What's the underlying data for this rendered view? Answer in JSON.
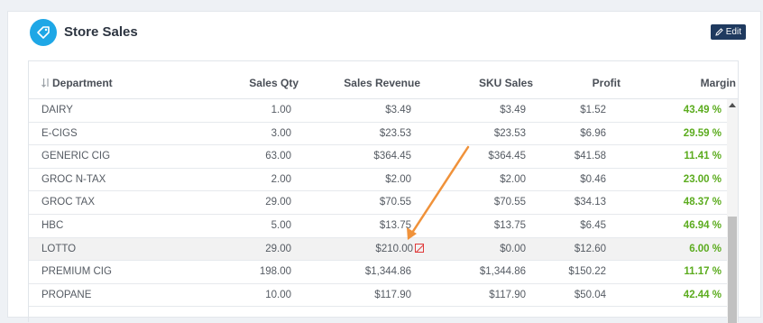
{
  "widget": {
    "title": "Store Sales",
    "edit_label": "Edit",
    "icon": "tag-icon"
  },
  "table": {
    "columns": [
      "Department",
      "Sales Qty",
      "Sales Revenue",
      "SKU Sales",
      "Profit",
      "Margin"
    ],
    "rows": [
      {
        "dept": "DAIRY",
        "qty": "1.00",
        "rev": "$3.49",
        "sku": "$3.49",
        "profit": "$1.52",
        "margin": "43.49 %"
      },
      {
        "dept": "E-CIGS",
        "qty": "3.00",
        "rev": "$23.53",
        "sku": "$23.53",
        "profit": "$6.96",
        "margin": "29.59 %"
      },
      {
        "dept": "GENERIC CIG",
        "qty": "63.00",
        "rev": "$364.45",
        "sku": "$364.45",
        "profit": "$41.58",
        "margin": "11.41 %"
      },
      {
        "dept": "GROC N-TAX",
        "qty": "2.00",
        "rev": "$2.00",
        "sku": "$2.00",
        "profit": "$0.46",
        "margin": "23.00 %"
      },
      {
        "dept": "GROC TAX",
        "qty": "29.00",
        "rev": "$70.55",
        "sku": "$70.55",
        "profit": "$34.13",
        "margin": "48.37 %"
      },
      {
        "dept": "HBC",
        "qty": "5.00",
        "rev": "$13.75",
        "sku": "$13.75",
        "profit": "$6.45",
        "margin": "46.94 %"
      },
      {
        "dept": "LOTTO",
        "qty": "29.00",
        "rev": "$210.00",
        "sku": "$0.00",
        "profit": "$12.60",
        "margin": "6.00 %"
      },
      {
        "dept": "PREMIUM CIG",
        "qty": "198.00",
        "rev": "$1,344.86",
        "sku": "$1,344.86",
        "profit": "$150.22",
        "margin": "11.17 %"
      },
      {
        "dept": "PROPANE",
        "qty": "10.00",
        "rev": "$117.90",
        "sku": "$117.90",
        "profit": "$50.04",
        "margin": "42.44 %"
      }
    ]
  },
  "colors": {
    "accent": "#1ea7e6",
    "edit_button": "#1f3a5f",
    "margin_text": "#5cac1f",
    "warning": "#e03a3a",
    "annotation_arrow": "#f0923a"
  }
}
